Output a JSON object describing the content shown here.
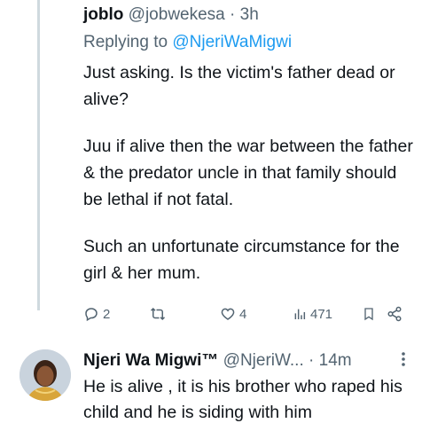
{
  "reply_tweet": {
    "name": "joblo",
    "handle": "@jobwekesa",
    "separator": "·",
    "time": "3h",
    "replying_prefix": "Replying to",
    "replying_to": "@NjeriWaMigwi",
    "paragraphs": [
      "Just asking. Is the victim's father dead or alive?",
      "Juu if alive then the war between the father & the predator uncle in that family should be lethal if not fatal.",
      "Such an unfortunate circumstance for the girl & her mum."
    ],
    "actions": {
      "reply_count": "2",
      "retweet_count": "",
      "like_count": "4",
      "views_count": "471"
    }
  },
  "next_tweet": {
    "name": "Njeri Wa Migwi™",
    "handle": "@NjeriW...",
    "separator": "·",
    "time": "14m",
    "text": "He is alive , it is his brother who raped his child and he is siding with him"
  },
  "colors": {
    "accent": "#1d9bf0",
    "muted": "#536471",
    "text": "#0f1419",
    "thread_line": "#cfd9de"
  },
  "icons": [
    "reply-icon",
    "retweet-icon",
    "like-icon",
    "views-icon",
    "bookmark-icon",
    "share-icon",
    "more-icon"
  ]
}
